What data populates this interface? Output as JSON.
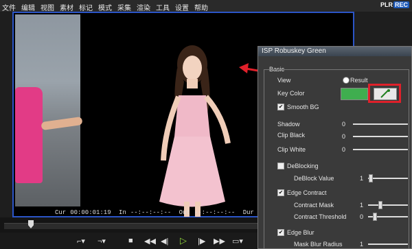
{
  "menu": [
    "文件",
    "编辑",
    "视图",
    "素材",
    "标记",
    "模式",
    "采集",
    "渲染",
    "工具",
    "设置",
    "帮助"
  ],
  "brand": {
    "name": "PLR",
    "rec": "REC"
  },
  "timecode": {
    "cur_label": "Cur",
    "cur_value": "00:00:01:19",
    "in_label": "In",
    "in_value": "--:--:--:--",
    "out_label": "Out",
    "out_value": "--:--:--:--",
    "dur_label": "Dur",
    "dur_value": "--:--:--:--"
  },
  "panel": {
    "title": "ISP Robuskey Green",
    "section": "Basic",
    "view_label": "View",
    "view_option": "Result",
    "key_color_label": "Key Color",
    "key_color": "#3fae4f",
    "smooth_bg": "Smooth BG",
    "shadow": "Shadow",
    "shadow_value": "0",
    "clip_black": "Clip Black",
    "clip_black_value": "0",
    "clip_white": "Clip White",
    "clip_white_value": "0",
    "deblocking": "DeBlocking",
    "deblock_value_label": "DeBlock Value",
    "deblock_value": "1",
    "edge_contract": "Edge Contract",
    "contract_mask": "Contract Mask",
    "contract_mask_value": "1",
    "contract_threshold": "Contract Threshold",
    "contract_threshold_value": "0",
    "edge_blur": "Edge Blur",
    "mask_blur_radius": "Mask Blur Radius",
    "mask_blur_radius_value": "1"
  },
  "colors": {
    "highlight": "#e0202a",
    "accent": "#2b55c8",
    "play": "#8fd33a"
  },
  "icons": [
    "eyedropper-icon",
    "play-icon",
    "rewind-icon",
    "fast-forward-icon",
    "step-back-icon",
    "step-forward-icon",
    "mark-in-icon",
    "mark-out-icon",
    "stop-icon",
    "monitor-icon"
  ]
}
